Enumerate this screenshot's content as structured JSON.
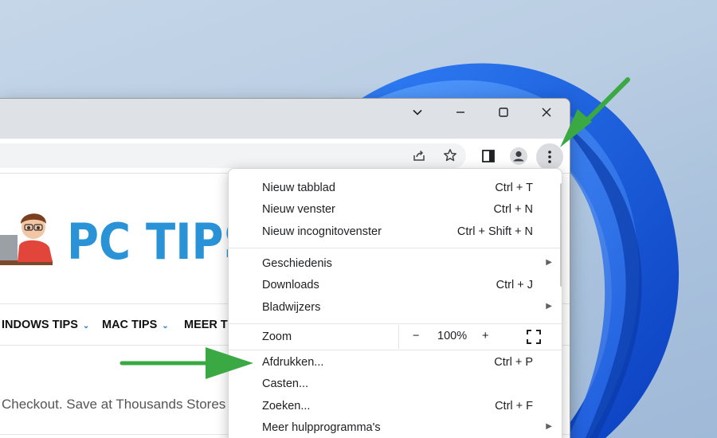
{
  "colors": {
    "accent_arrow": "#3aa843",
    "logo_blue": "#2a93d8",
    "desktop_blue": "#1f5fe0"
  },
  "window_controls": {
    "dropdown_icon": "chevron-down-icon",
    "minimize_icon": "minimize-icon",
    "maximize_icon": "maximize-icon",
    "close_icon": "close-icon"
  },
  "toolbar": {
    "share_icon": "share-icon",
    "bookmark_icon": "star-icon",
    "sidepanel_icon": "side-panel-icon",
    "profile_icon": "profile-avatar-icon",
    "menu_icon": "three-dots-menu-icon"
  },
  "site": {
    "logo_text": "PC TIPS",
    "nav": [
      {
        "label": "INDOWS TIPS"
      },
      {
        "label": "MAC TIPS"
      },
      {
        "label": "MEER TI"
      }
    ],
    "promo_text": "Checkout. Save at Thousands Stores"
  },
  "menu": {
    "items_group1": [
      {
        "label": "Nieuw tabblad",
        "shortcut": "Ctrl + T"
      },
      {
        "label": "Nieuw venster",
        "shortcut": "Ctrl + N"
      },
      {
        "label": "Nieuw incognitovenster",
        "shortcut": "Ctrl + Shift + N"
      }
    ],
    "items_group2": [
      {
        "label": "Geschiedenis",
        "shortcut": ""
      },
      {
        "label": "Downloads",
        "shortcut": "Ctrl + J"
      },
      {
        "label": "Bladwijzers",
        "shortcut": ""
      }
    ],
    "zoom": {
      "label": "Zoom",
      "minus": "−",
      "value": "100%",
      "plus": "+"
    },
    "items_group3": [
      {
        "label": "Afdrukken...",
        "shortcut": "Ctrl + P"
      },
      {
        "label": "Casten...",
        "shortcut": ""
      },
      {
        "label": "Zoeken...",
        "shortcut": "Ctrl + F"
      },
      {
        "label": "Meer hulpprogramma's",
        "shortcut": ""
      }
    ]
  }
}
